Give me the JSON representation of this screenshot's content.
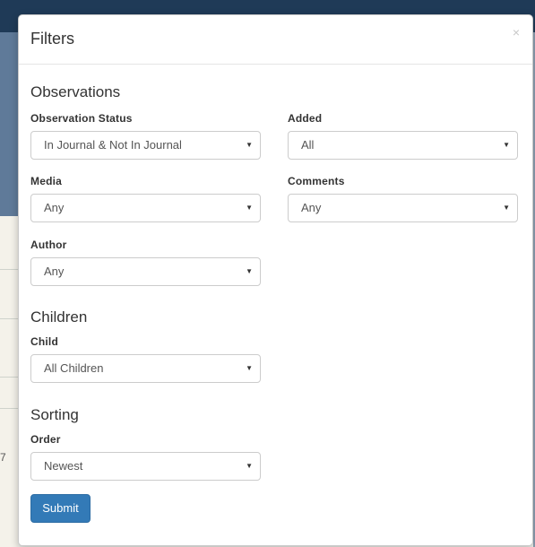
{
  "modal": {
    "title": "Filters",
    "close_glyph": "×",
    "submit_label": "Submit"
  },
  "sections": {
    "observations": "Observations",
    "children": "Children",
    "sorting": "Sorting"
  },
  "fields": {
    "observation_status": {
      "label": "Observation Status",
      "value": "In Journal & Not In Journal"
    },
    "added": {
      "label": "Added",
      "value": "All"
    },
    "media": {
      "label": "Media",
      "value": "Any"
    },
    "comments": {
      "label": "Comments",
      "value": "Any"
    },
    "author": {
      "label": "Author",
      "value": "Any"
    },
    "child": {
      "label": "Child",
      "value": "All Children"
    },
    "order": {
      "label": "Order",
      "value": "Newest"
    }
  },
  "select_caret_icon": "caret-down-icon",
  "background_partial_text": "7",
  "colors": {
    "primary": "#337ab7",
    "header_bar": "#1f3a57"
  }
}
